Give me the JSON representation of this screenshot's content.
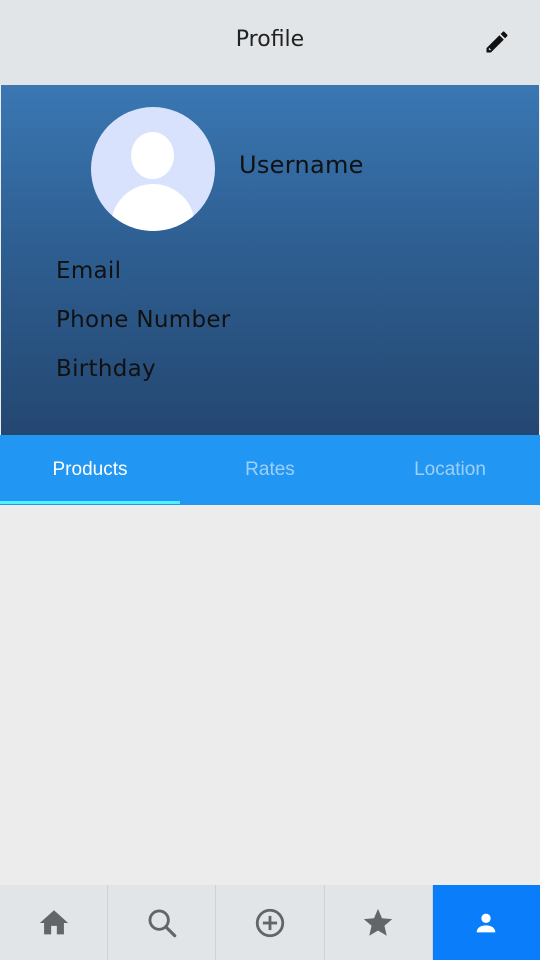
{
  "appbar": {
    "title": "Profile",
    "edit_icon": "pencil-icon"
  },
  "profile": {
    "avatar_icon": "user-avatar-icon",
    "username": "Username",
    "email": "Email",
    "phone": "Phone Number",
    "birthday": "Birthday"
  },
  "tabs": [
    {
      "label": "Products",
      "active": true
    },
    {
      "label": "Rates",
      "active": false
    },
    {
      "label": "Location",
      "active": false
    }
  ],
  "bottom_nav": [
    {
      "icon": "home-icon",
      "active": false
    },
    {
      "icon": "search-icon",
      "active": false
    },
    {
      "icon": "add-circle-icon",
      "active": false
    },
    {
      "icon": "star-icon",
      "active": false
    },
    {
      "icon": "person-icon",
      "active": true
    }
  ],
  "colors": {
    "tab_bar": "#2196f3",
    "tab_indicator": "#4ff0ff",
    "nav_active": "#0a7dfb",
    "header_top": "#3a77b3",
    "header_bottom": "#244771"
  }
}
